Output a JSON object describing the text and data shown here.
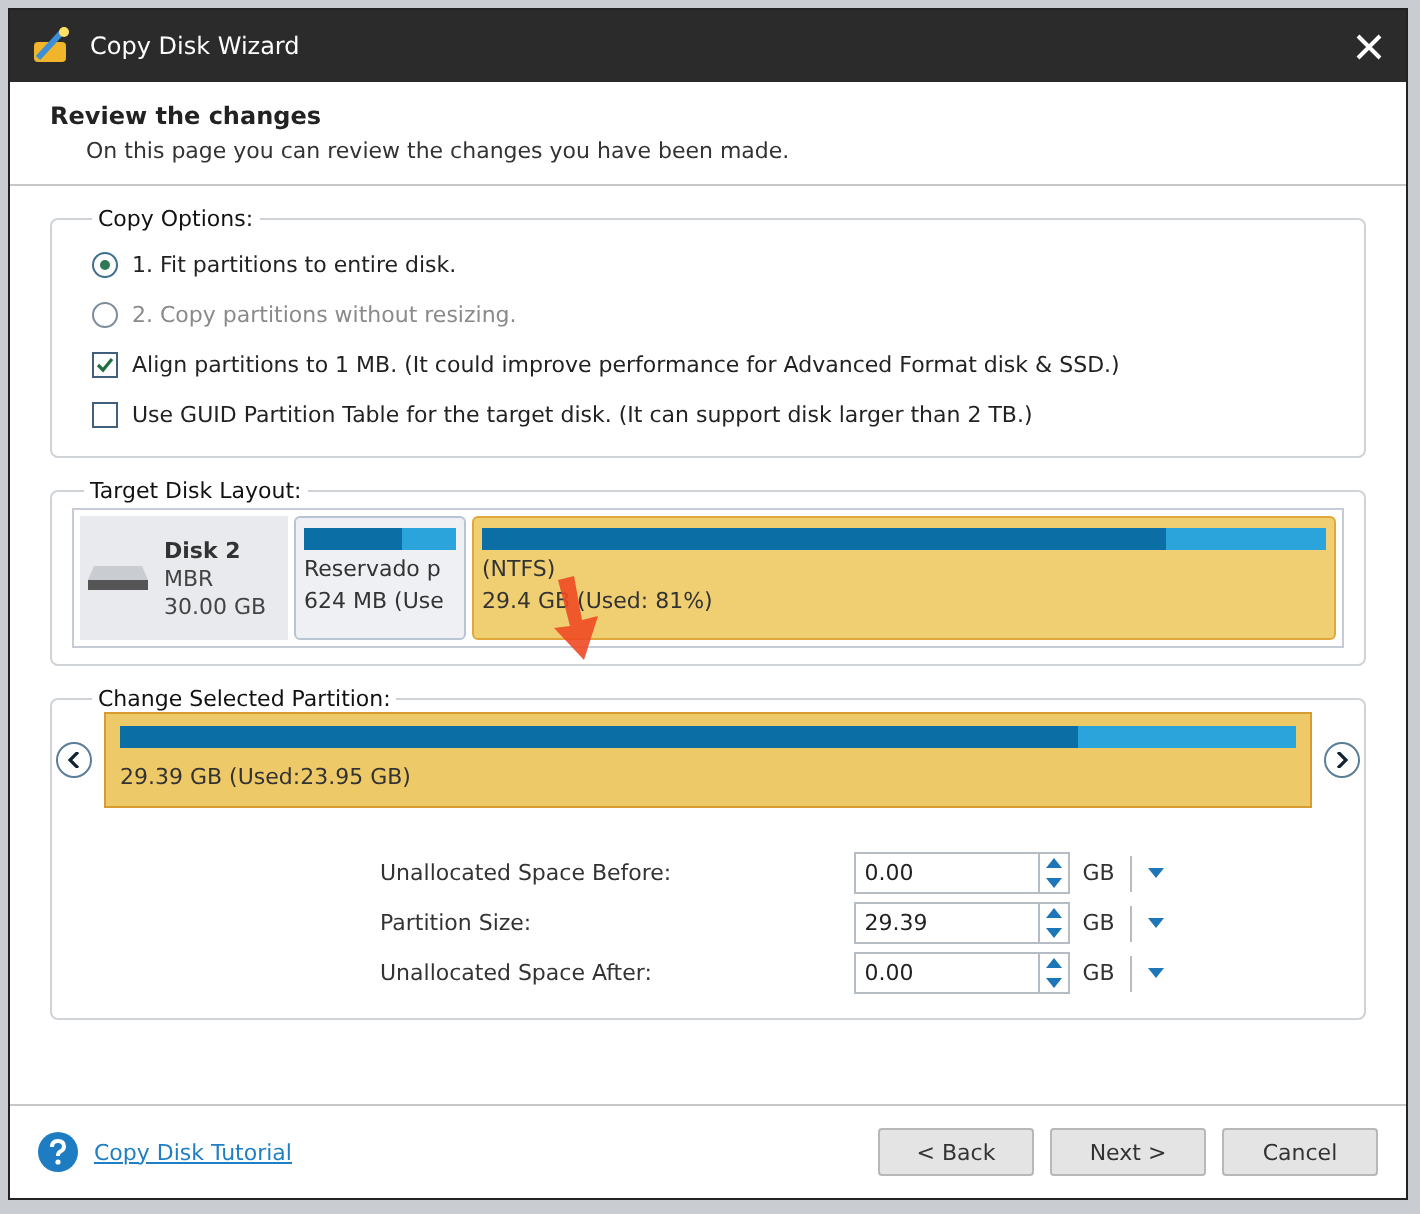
{
  "window": {
    "title": "Copy Disk Wizard"
  },
  "header": {
    "title": "Review the changes",
    "subtitle": "On this page you can review the changes you have been made."
  },
  "copy_options": {
    "legend": "Copy Options:",
    "options": [
      {
        "kind": "radio",
        "label": "1. Fit partitions to entire disk.",
        "selected": true,
        "disabled": false
      },
      {
        "kind": "radio",
        "label": "2. Copy partitions without resizing.",
        "selected": false,
        "disabled": true
      },
      {
        "kind": "checkbox",
        "label": "Align partitions to 1 MB.  (It could improve performance for Advanced Format disk & SSD.)",
        "checked": true,
        "disabled": false
      },
      {
        "kind": "checkbox",
        "label": "Use GUID Partition Table for the target disk. (It can support disk larger than 2 TB.)",
        "checked": false,
        "disabled": false
      }
    ]
  },
  "target_disk_layout": {
    "legend": "Target Disk Layout:",
    "disk": {
      "name": "Disk 2",
      "type": "MBR",
      "size": "30.00 GB"
    },
    "partitions": [
      {
        "name": "Reservado p",
        "size": "624 MB (Use",
        "level": 0.64,
        "selected": false
      },
      {
        "name": "(NTFS)",
        "size": "29.4 GB (Used: 81%)",
        "level": 0.81,
        "selected": true
      }
    ]
  },
  "change_selected_partition": {
    "legend": "Change Selected Partition:",
    "partition": {
      "size": "29.39 GB (Used:23.95 GB)",
      "level": 0.815
    },
    "fields": [
      {
        "label": "Unallocated Space Before:",
        "value": "0.00",
        "unit": "GB"
      },
      {
        "label": "Partition Size:",
        "value": "29.39",
        "unit": "GB"
      },
      {
        "label": "Unallocated Space After:",
        "value": "0.00",
        "unit": "GB"
      }
    ]
  },
  "footer": {
    "help_link": "Copy Disk Tutorial",
    "buttons": [
      "< Back",
      "Next >",
      "Cancel"
    ]
  }
}
